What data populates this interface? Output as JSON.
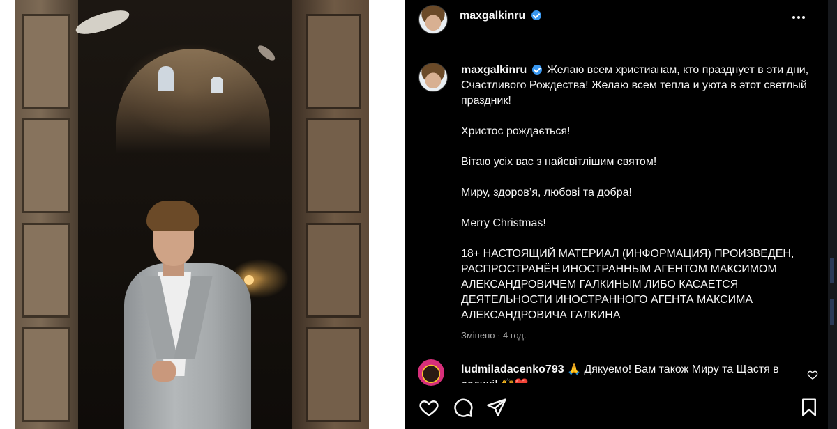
{
  "post": {
    "username": "maxgalkinru",
    "caption_first": "Желаю всем христианам, кто празднует в эти дни, Счастливого Рождества! Желаю всем тепла и уюта в этот светлый праздник!",
    "paragraphs": [
      "Христос рождається!",
      "Вітаю усіх вас з найсвітлішим святом!",
      "Миру, здоров’я, любові та добра!",
      "Merry Christmas!",
      "18+ НАСТОЯЩИЙ МАТЕРИАЛ (ИНФОРМАЦИЯ) ПРОИЗВЕДЕН, РАСПРОСТРАНЁН ИНОСТРАННЫМ АГЕНТОМ МАКСИМОМ АЛЕКСАНДРОВИЧЕМ ГАЛКИНЫМ ЛИБО КАСАЕТСЯ ДЕЯТЕЛЬНОСТИ ИНОСТРАННОГО АГЕНТА МАКСИМА АЛЕКСАНДРОВИЧА ГАЛКИНА"
    ],
    "edited_label": "Змінено · 4 год."
  },
  "comment": {
    "username": "ludmiladacenko793",
    "text": "🙏 Дякуемо! Вам також Миру та Щастя в родині! 🙌❤️"
  },
  "icons": {
    "more": "more-options-icon",
    "verified": "verified-badge-icon",
    "like": "heart-icon",
    "comment": "comment-icon",
    "share": "share-icon",
    "save": "bookmark-icon"
  },
  "colors": {
    "panel_bg": "#000000",
    "text": "#f5f5f5",
    "meta": "#a8a8a8",
    "verified": "#3897f0"
  }
}
